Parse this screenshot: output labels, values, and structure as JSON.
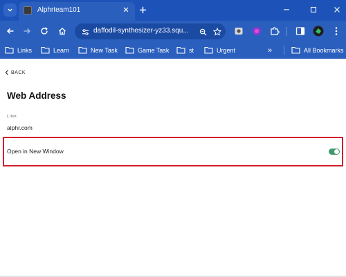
{
  "browser": {
    "tab": {
      "title": "Alphrteam101"
    },
    "window_controls": [
      "minimize",
      "maximize",
      "close"
    ],
    "toolbar": {
      "url": "daffodil-synthesizer-yz33.squ..."
    },
    "bookmarks": [
      {
        "label": "Links"
      },
      {
        "label": "Learn"
      },
      {
        "label": "New Task"
      },
      {
        "label": "Game Task"
      },
      {
        "label": "st"
      },
      {
        "label": "Urgent"
      }
    ],
    "overflow_label": "»",
    "all_bookmarks_label": "All Bookmarks"
  },
  "page": {
    "back_label": "BACK",
    "title": "Web Address",
    "link_field": {
      "label": "LINK",
      "value": "alphr.com"
    },
    "open_in_new_window": {
      "label": "Open in New Window",
      "enabled": true
    }
  },
  "colors": {
    "chrome_blue": "#2a5fbe",
    "tab_strip": "#1d53b8",
    "highlight_red": "#d21f2c",
    "toggle_green": "#3f9b6d"
  }
}
